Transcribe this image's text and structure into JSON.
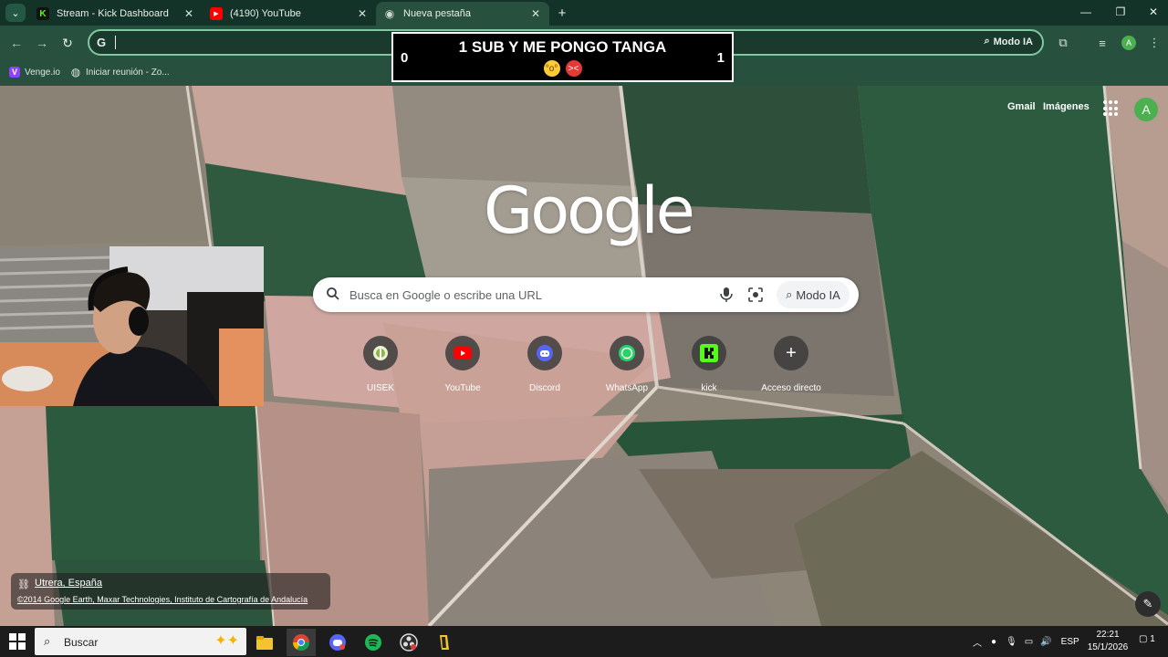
{
  "browser": {
    "tabs": [
      {
        "title": "Stream - Kick Dashboard",
        "icon": "kick-icon",
        "color": "#53fc18",
        "glyph": "K"
      },
      {
        "title": "(4190) YouTube",
        "icon": "youtube-icon",
        "color": "#ff0000",
        "glyph": "▶"
      },
      {
        "title": "Nueva pestaña",
        "icon": "chrome-newtab-icon",
        "color": "#cfd8d3",
        "glyph": "◉",
        "active": true
      }
    ],
    "omnibox": {
      "modo_label": "Modo IA"
    },
    "bookmarks": [
      {
        "label": "Venge.io",
        "icon": "venge-icon",
        "color": "#8e44ff",
        "glyph": "V"
      },
      {
        "label": "Iniciar reunión - Zo...",
        "icon": "globe-icon",
        "color": "#5a6b62",
        "glyph": "◍"
      }
    ]
  },
  "overlay": {
    "headline": "1 SUB Y ME PONGO TANGA",
    "score_left": "0",
    "score_right": "1"
  },
  "newtab": {
    "links": {
      "gmail": "Gmail",
      "images": "Imágenes"
    },
    "profile_initial": "A",
    "logo": "Google",
    "search": {
      "placeholder": "Busca en Google o escribe una URL",
      "modo_ia": "Modo IA"
    },
    "shortcuts": [
      {
        "label": "UISEK",
        "icon": "uisek-icon"
      },
      {
        "label": "YouTube",
        "icon": "youtube-icon"
      },
      {
        "label": "Discord",
        "icon": "discord-icon"
      },
      {
        "label": "WhatsApp",
        "icon": "whatsapp-icon"
      },
      {
        "label": "kick",
        "icon": "kick-icon"
      },
      {
        "label": "Acceso directo",
        "icon": "plus-icon"
      }
    ],
    "credit": {
      "location": "Utrera, España",
      "copyright": "©2014 Google Earth, Maxar Technologies, Instituto de Cartografía de Andalucía"
    }
  },
  "taskbar": {
    "search_label": "Buscar",
    "language": "ESP",
    "time": "22:21",
    "date": "15/1/2026",
    "notifications": "1"
  }
}
